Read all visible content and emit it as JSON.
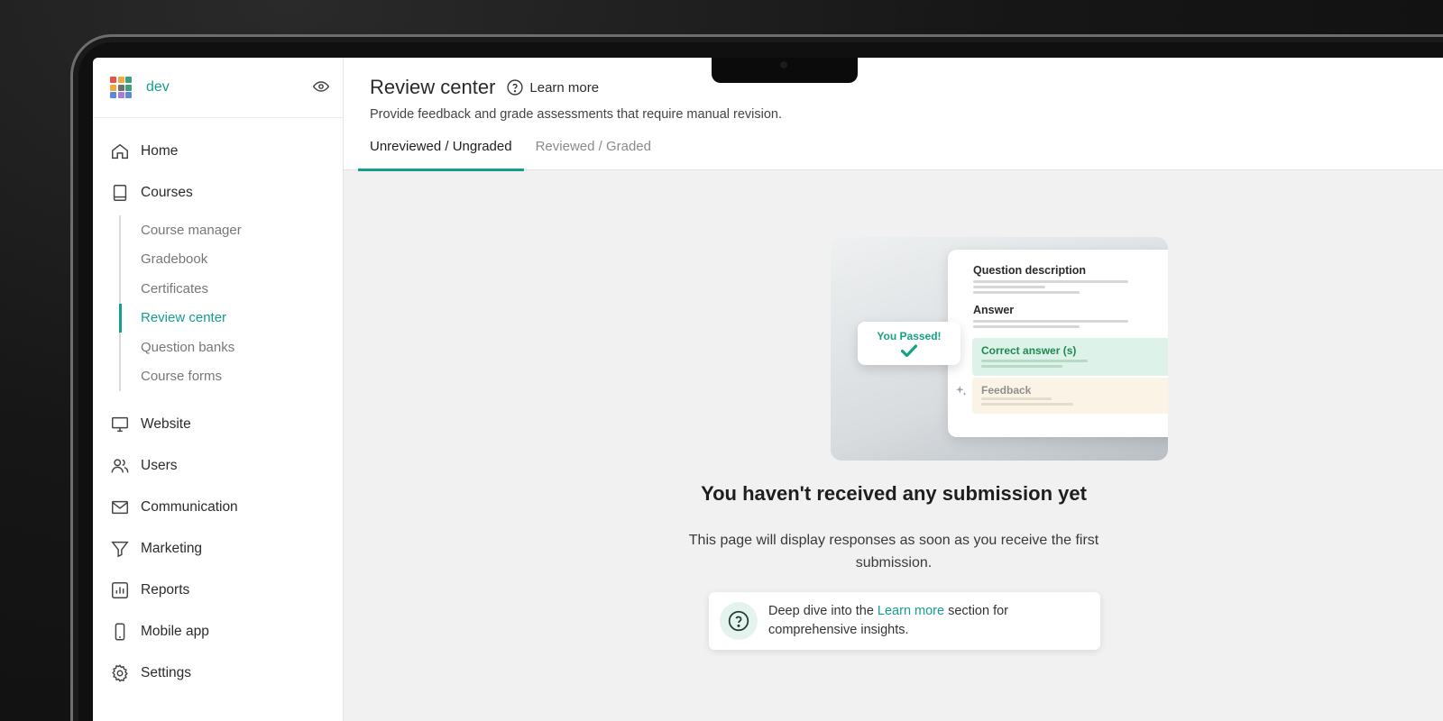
{
  "app": {
    "workspace_name": "dev",
    "brand_colors": [
      "#e2554b",
      "#f2a93b",
      "#3aa07f",
      "#f2a93b",
      "#6f6f6f",
      "#3aa07f",
      "#5b8ad9",
      "#a77ad6",
      "#5b8ad9"
    ],
    "accent": "#149e8f"
  },
  "sidebar": {
    "items": [
      {
        "label": "Home",
        "icon": "home-icon"
      },
      {
        "label": "Courses",
        "icon": "book-icon"
      },
      {
        "label": "Website",
        "icon": "monitor-icon"
      },
      {
        "label": "Users",
        "icon": "users-icon"
      },
      {
        "label": "Communication",
        "icon": "mail-icon"
      },
      {
        "label": "Marketing",
        "icon": "funnel-icon"
      },
      {
        "label": "Reports",
        "icon": "bar-chart-icon"
      },
      {
        "label": "Mobile app",
        "icon": "phone-icon"
      },
      {
        "label": "Settings",
        "icon": "gear-icon"
      }
    ],
    "courses_sub": [
      {
        "label": "Course manager"
      },
      {
        "label": "Gradebook"
      },
      {
        "label": "Certificates"
      },
      {
        "label": "Review center",
        "active": true
      },
      {
        "label": "Question banks"
      },
      {
        "label": "Course forms"
      }
    ]
  },
  "header": {
    "title": "Review center",
    "learn_more": "Learn more",
    "subtitle": "Provide feedback and grade assessments that require manual revision.",
    "tabs": [
      {
        "label": "Unreviewed / Ungraded",
        "active": true
      },
      {
        "label": "Reviewed / Graded",
        "active": false
      }
    ]
  },
  "illustration": {
    "question_description": "Question description",
    "answer": "Answer",
    "correct_answer": "Correct answer (s)",
    "feedback": "Feedback",
    "you_passed": "You Passed!"
  },
  "empty_state": {
    "title": "You haven't received any submission yet",
    "description": "This page will display responses as soon as you receive the first submission.",
    "tip_prefix": "Deep dive into the ",
    "tip_link": "Learn more",
    "tip_suffix": " section for comprehensive insights."
  }
}
